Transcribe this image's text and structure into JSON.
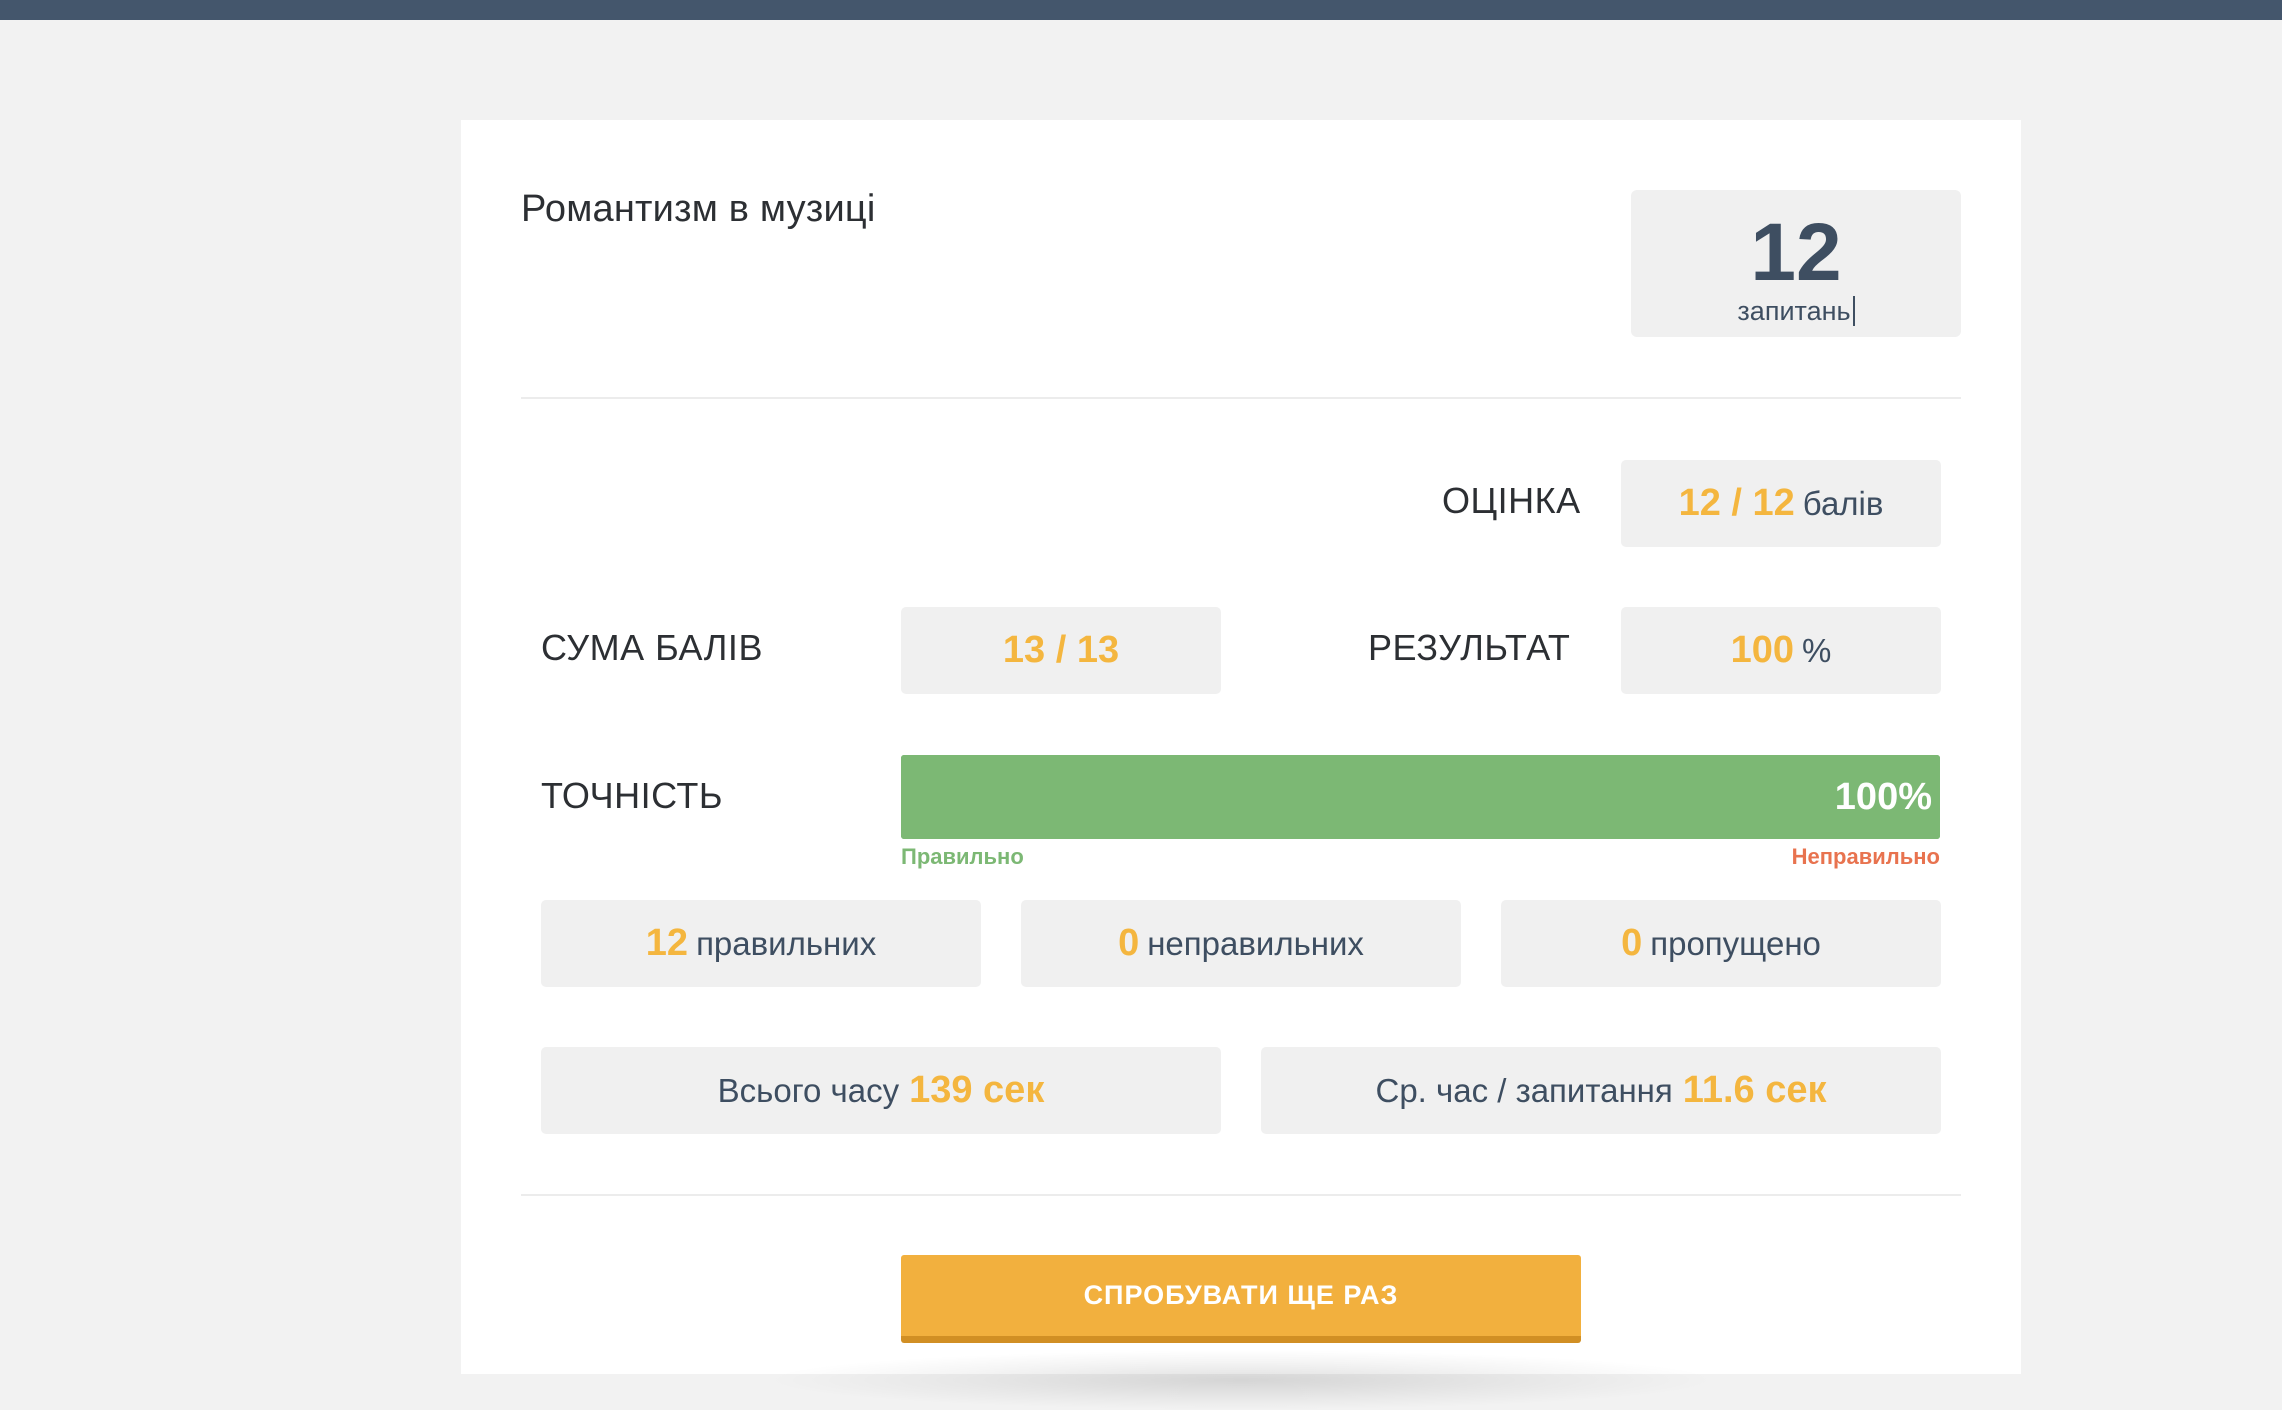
{
  "quiz": {
    "title": "Романтизм в музиці",
    "question_count": "12",
    "question_count_label": "запитань"
  },
  "score": {
    "label": "ОЦІНКА",
    "value": "12 / 12",
    "unit": "балів"
  },
  "points_sum": {
    "label": "СУМА БАЛІВ",
    "value": "13 / 13"
  },
  "result": {
    "label": "РЕЗУЛЬТАТ",
    "value": "100",
    "unit": "%"
  },
  "accuracy": {
    "label": "ТОЧНІСТЬ",
    "percent_text": "100%",
    "correct_fraction": 1.0,
    "legend_correct": "Правильно",
    "legend_wrong": "Неправильно"
  },
  "answers": {
    "correct_count": "12",
    "correct_label": "правильних",
    "wrong_count": "0",
    "wrong_label": "неправильних",
    "skipped_count": "0",
    "skipped_label": "пропущено"
  },
  "timing": {
    "total_label": "Всього часу",
    "total_value": "139 сек",
    "avg_label": "Ср. час / запитання",
    "avg_value": "11.6 сек"
  },
  "actions": {
    "retry_label": "СПРОБУВАТИ ЩЕ РАЗ"
  },
  "colors": {
    "accent": "#f4b63f",
    "correct": "#7cb874",
    "wrong": "#e8734f",
    "header": "#44566c"
  }
}
